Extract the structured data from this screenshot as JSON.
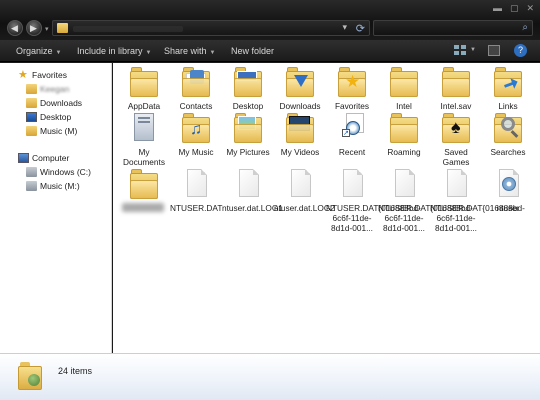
{
  "window": {
    "controls": {
      "minimize": "▬",
      "maximize": "▢",
      "close": "✕"
    }
  },
  "toolbar": {
    "organize": "Organize",
    "include_in_library": "Include in library",
    "share_with": "Share with",
    "new_folder": "New folder",
    "help": "?"
  },
  "nav": {
    "favorites": "Favorites",
    "fav_items": [
      "Keegan",
      "Downloads",
      "Desktop",
      "Music (M)"
    ],
    "computer": "Computer",
    "comp_items": [
      "Windows (C:)",
      "Music (M:)"
    ]
  },
  "items": [
    {
      "label": "AppData",
      "icon": "folder-icon"
    },
    {
      "label": "Contacts",
      "icon": "contacts-folder-icon"
    },
    {
      "label": "Desktop",
      "icon": "desktop-folder-icon"
    },
    {
      "label": "Downloads",
      "icon": "downloads-folder-icon"
    },
    {
      "label": "Favorites",
      "icon": "favorites-folder-icon"
    },
    {
      "label": "Intel",
      "icon": "folder-icon"
    },
    {
      "label": "Intel.sav",
      "icon": "folder-icon"
    },
    {
      "label": "Links",
      "icon": "links-folder-icon"
    },
    {
      "label": "My Documents",
      "icon": "documents-folder-icon"
    },
    {
      "label": "My Music",
      "icon": "music-folder-icon"
    },
    {
      "label": "My Pictures",
      "icon": "pictures-folder-icon"
    },
    {
      "label": "My Videos",
      "icon": "videos-folder-icon"
    },
    {
      "label": "Recent",
      "icon": "recent-shortcut-icon"
    },
    {
      "label": "Roaming",
      "icon": "folder-icon"
    },
    {
      "label": "Saved Games",
      "icon": "saved-games-folder-icon"
    },
    {
      "label": "Searches",
      "icon": "searches-folder-icon"
    },
    {
      "label": "",
      "icon": "folder-icon"
    },
    {
      "label": "NTUSER.DAT",
      "icon": "file-icon"
    },
    {
      "label": "ntuser.dat.LOG1",
      "icon": "file-icon"
    },
    {
      "label": "ntuser.dat.LOG2",
      "icon": "file-icon"
    },
    {
      "label": "NTUSER.DAT{016888bd-6c6f-11de-8d1d-001...",
      "icon": "file-icon"
    },
    {
      "label": "NTUSER.DAT{016888bd-6c6f-11de-8d1d-001...",
      "icon": "file-icon"
    },
    {
      "label": "NTUSER.DAT{016888bd-6c6f-11de-8d1d-001...",
      "icon": "file-icon"
    },
    {
      "label": "ntuser",
      "icon": "config-file-icon"
    }
  ],
  "status": {
    "count": "24 items"
  }
}
